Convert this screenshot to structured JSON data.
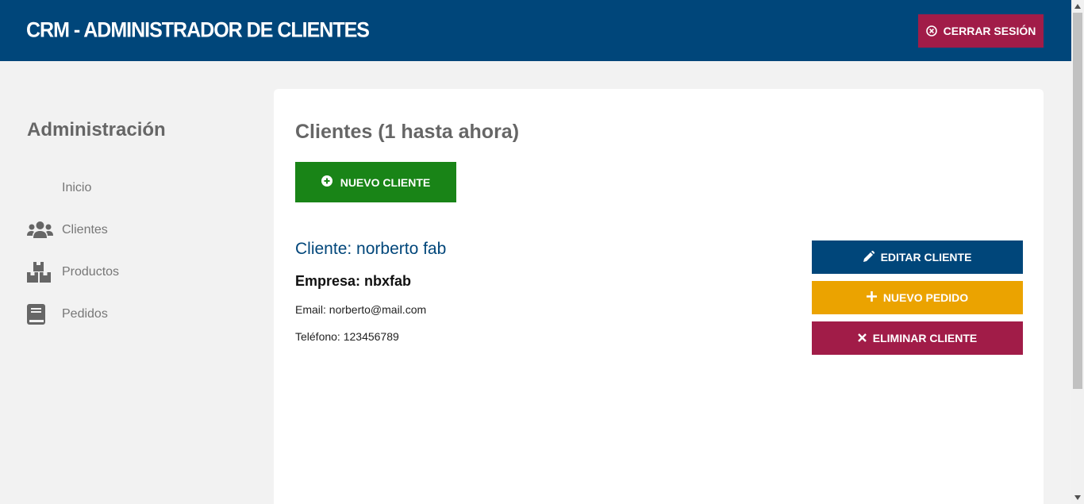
{
  "header": {
    "title": "CRM - Administrador de Clientes",
    "logout_label": "CERRAR SESIÓN"
  },
  "sidebar": {
    "title": "Administración",
    "items": [
      {
        "label": "Inicio",
        "icon": "none"
      },
      {
        "label": "Clientes",
        "icon": "users-icon"
      },
      {
        "label": "Productos",
        "icon": "boxes-icon"
      },
      {
        "label": "Pedidos",
        "icon": "book-icon"
      }
    ]
  },
  "main": {
    "title": "Clientes (1 hasta ahora)",
    "new_client_label": "NUEVO CLIENTE",
    "client": {
      "name": "Cliente: norberto fab",
      "company": "Empresa: nbxfab",
      "email": "Email: norberto@mail.com",
      "phone": "Teléfono: 123456789"
    },
    "actions": {
      "edit": "EDITAR CLIENTE",
      "new_order": "NUEVO PEDIDO",
      "delete": "ELIMINAR CLIENTE"
    }
  },
  "colors": {
    "primary": "#00467a",
    "danger": "#a11c48",
    "success": "#198417",
    "warning": "#eba300"
  }
}
